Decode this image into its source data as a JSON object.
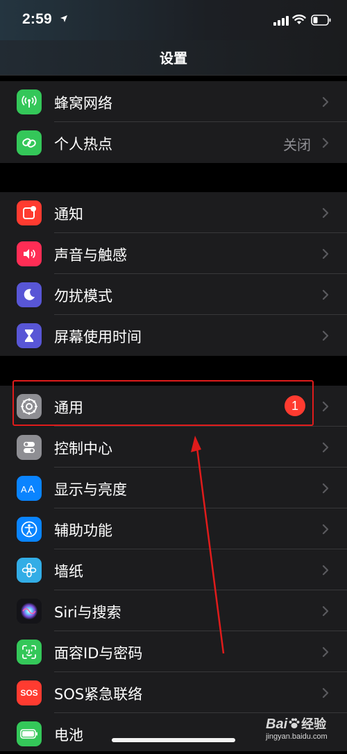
{
  "status_bar": {
    "time": "2:59",
    "icons": [
      "location-arrow-icon",
      "cellular-signal-icon",
      "wifi-icon",
      "battery-icon"
    ]
  },
  "nav": {
    "title": "设置"
  },
  "groups": [
    {
      "items": [
        {
          "label": "蜂窝网络",
          "icon": "antenna-icon",
          "icon_color": "#34c759"
        },
        {
          "label": "个人热点",
          "icon": "link-icon",
          "icon_color": "#34c759",
          "value": "关闭"
        }
      ]
    },
    {
      "items": [
        {
          "label": "通知",
          "icon": "notification-icon",
          "icon_color": "#ff3b30"
        },
        {
          "label": "声音与触感",
          "icon": "speaker-icon",
          "icon_color": "#ff2d55"
        },
        {
          "label": "勿扰模式",
          "icon": "moon-icon",
          "icon_color": "#5856d6"
        },
        {
          "label": "屏幕使用时间",
          "icon": "hourglass-icon",
          "icon_color": "#5856d6"
        }
      ]
    },
    {
      "items": [
        {
          "label": "通用",
          "icon": "gear-icon",
          "icon_color": "#8e8e93",
          "badge": "1"
        },
        {
          "label": "控制中心",
          "icon": "toggles-icon",
          "icon_color": "#8e8e93"
        },
        {
          "label": "显示与亮度",
          "icon": "text-size-icon",
          "icon_color": "#0a84ff"
        },
        {
          "label": "辅助功能",
          "icon": "accessibility-icon",
          "icon_color": "#0a84ff"
        },
        {
          "label": "墙纸",
          "icon": "flower-icon",
          "icon_color": "#32ade6"
        },
        {
          "label": "Siri与搜索",
          "icon": "siri-icon",
          "icon_color": "#1c1c1e"
        },
        {
          "label": "面容ID与密码",
          "icon": "face-id-icon",
          "icon_color": "#34c759"
        },
        {
          "label": "SOS紧急联络",
          "icon": "sos-icon",
          "icon_color": "#ff3b30",
          "icon_text": "SOS"
        },
        {
          "label": "电池",
          "icon": "battery-settings-icon",
          "icon_color": "#34c759"
        }
      ]
    }
  ],
  "annotation": {
    "highlight_color": "#e01b1b"
  },
  "watermark": {
    "brand": "Bai",
    "word": "经验",
    "domain": "jingyan.baidu.com"
  }
}
